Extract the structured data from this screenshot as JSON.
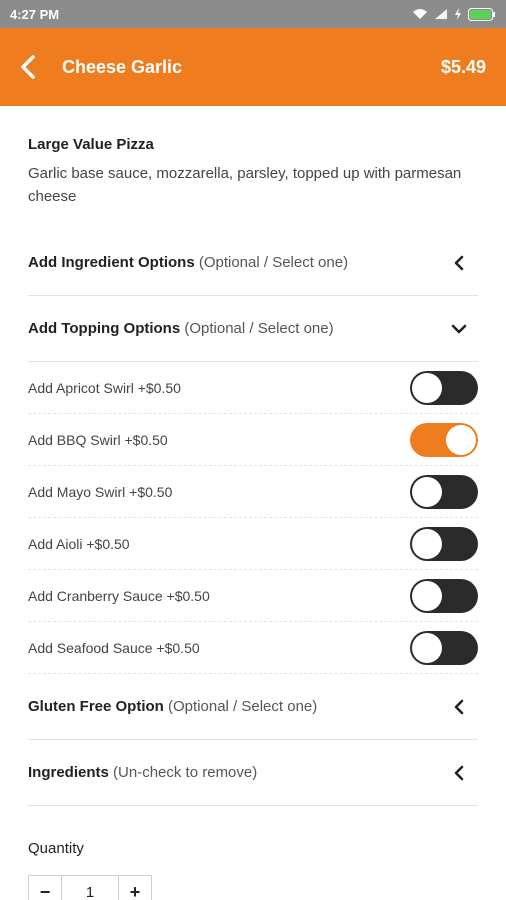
{
  "status": {
    "time": "4:27 PM"
  },
  "header": {
    "title": "Cheese Garlic",
    "price": "$5.49"
  },
  "product": {
    "name": "Large Value Pizza",
    "description": "Garlic base sauce, mozzarella, parsley, topped up with parmesan cheese"
  },
  "sections": {
    "ingredient_options": {
      "title": "Add Ingredient Options",
      "sub": "(Optional / Select one)"
    },
    "topping_options": {
      "title": "Add Topping Options",
      "sub": "(Optional / Select one)"
    },
    "gluten_free": {
      "title": "Gluten Free Option",
      "sub": "(Optional / Select one)"
    },
    "ingredients": {
      "title": "Ingredients",
      "sub": "(Un-check to remove)"
    }
  },
  "toppings": [
    {
      "label": "Add Apricot Swirl +$0.50",
      "on": false
    },
    {
      "label": "Add BBQ Swirl +$0.50",
      "on": true
    },
    {
      "label": "Add Mayo Swirl +$0.50",
      "on": false
    },
    {
      "label": "Add Aioli +$0.50",
      "on": false
    },
    {
      "label": "Add Cranberry Sauce +$0.50",
      "on": false
    },
    {
      "label": "Add Seafood Sauce +$0.50",
      "on": false
    }
  ],
  "quantity": {
    "label": "Quantity",
    "value": "1",
    "minus": "−",
    "plus": "+"
  },
  "colors": {
    "accent": "#ef7d1f",
    "toggle_off": "#2b2b2b",
    "status_bar": "#8c8c8c"
  },
  "icons": {
    "back": "chevron-left-icon",
    "collapsed": "chevron-left-icon",
    "expanded": "chevron-down-icon"
  }
}
